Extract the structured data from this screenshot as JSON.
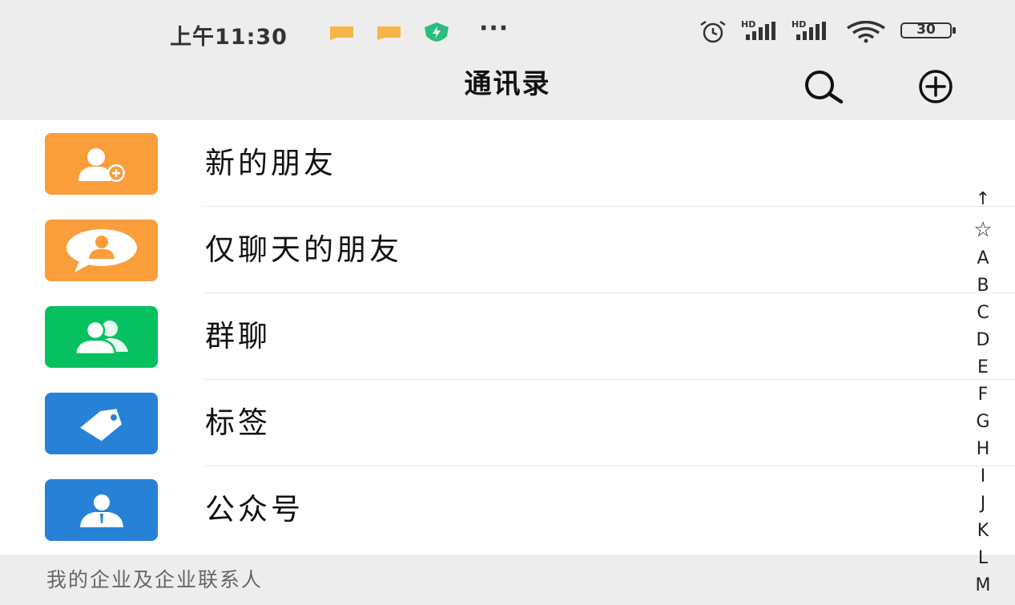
{
  "status_bar": {
    "time": "上午11:30",
    "more": "···",
    "battery": "30",
    "signal_1_label": "HD",
    "signal_2_label": "HD"
  },
  "nav": {
    "title": "通讯录"
  },
  "items": [
    {
      "label": "新的朋友",
      "icon": "add-friend-icon",
      "color": "#fa9d3b"
    },
    {
      "label": "仅聊天的朋友",
      "icon": "chat-only-friend-icon",
      "color": "#fa9d3b"
    },
    {
      "label": "群聊",
      "icon": "group-chat-icon",
      "color": "#07c160"
    },
    {
      "label": "标签",
      "icon": "tag-icon",
      "color": "#2782d7"
    },
    {
      "label": "公众号",
      "icon": "official-account-icon",
      "color": "#2782d7"
    }
  ],
  "section": {
    "label": "我的企业及企业联系人"
  },
  "index": [
    "↑",
    "☆",
    "A",
    "B",
    "C",
    "D",
    "E",
    "F",
    "G",
    "H",
    "I",
    "J",
    "K",
    "L",
    "M"
  ]
}
